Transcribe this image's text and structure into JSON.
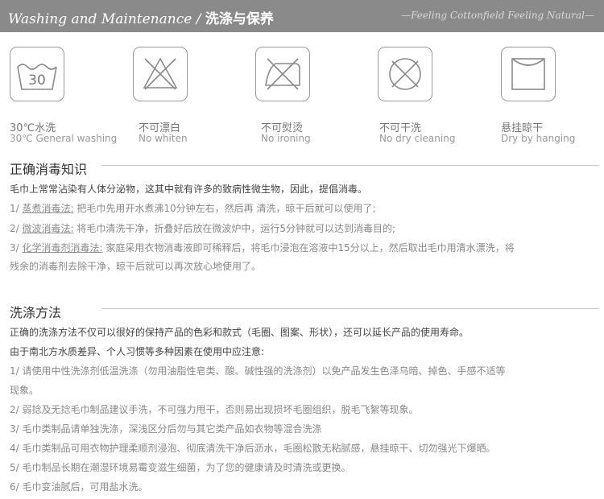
{
  "header": {
    "title_en": "Washing and Maintenance /",
    "title_cn": "洗涤与保养",
    "tagline": "—Feeling Cottonfield Feeling Natural—"
  },
  "care_icons": [
    {
      "icon": "wash-30-icon",
      "cn": "30℃水洗",
      "en": "30℃ General washing",
      "temp": "30"
    },
    {
      "icon": "no-bleach-icon",
      "cn": "不可漂白",
      "en": "No whiten"
    },
    {
      "icon": "no-ironing-icon",
      "cn": "不可熨烫",
      "en": "No ironing"
    },
    {
      "icon": "no-dry-cleaning-icon",
      "cn": "不可干洗",
      "en": "No dry cleaning"
    },
    {
      "icon": "hang-dry-icon",
      "cn": "悬挂晾干",
      "en": "Dry by hanging"
    }
  ],
  "disinfection": {
    "title": "正确消毒知识",
    "intro": "毛巾上常常沾染有人体分泌物，这其中就有许多的致病性微生物，因此，提倡消毒。",
    "items": [
      {
        "num": "1/ ",
        "label": "蒸煮消毒法:",
        "text": "  把毛巾先用开水煮沸10分钟左右，然后再 清洗，晾干后就可以使用了;"
      },
      {
        "num": "2/ ",
        "label": "微波消毒法:",
        "text": "  将毛巾清洗干净，折叠好后放在微波炉中，运行5分钟就可以达到消毒目的;"
      },
      {
        "num": "3/ ",
        "label": "化学消毒剂消毒法:",
        "text": "  家庭采用衣物消毒液即可稀释后，将毛巾浸泡在溶液中15分以上，然后取出毛巾用清水漂洗，将"
      }
    ],
    "continuation": "残余的消毒剂去除干净，晾干后就可以再次放心地使用了。"
  },
  "washing": {
    "title": "洗涤方法",
    "intro1": "正确的洗涤方法不仅可以很好的保持产品的色彩和款式（毛圈、图案、形状），还可以延长产品的使用寿命。",
    "intro2": "由于南北方水质差异、个人习惯等多种因素在使用中应注意:",
    "items": [
      "1/ 请使用中性洗涤剂低温洗涤（勿用油脂性皂类、酸、碱性强的洗涤剂）以免产品发生色泽乌暗、掉色、手感不适等",
      "现象。",
      "2/ 弱捻及无捻毛巾制品建议手洗，不可强力甩干，否则易出现损坏毛圈组织，脱毛飞絮等现象。",
      "3/ 毛巾类制品请单独洗涤，深浅区分后勿与其它类产品如衣物等混合洗涤",
      "4/ 毛巾类制品可用衣物护理柔顺剂浸泡、彻底清洗干净后沥水，毛圈松散无粘腻感，悬挂晾干、切勿强光下爆晒。",
      "5/ 毛巾制品长期在潮湿环境易霉变滋生细菌，为了您的健康请及时清洗或更换。",
      "6/ 毛巾变油腻后，可用盐水洗。"
    ]
  }
}
